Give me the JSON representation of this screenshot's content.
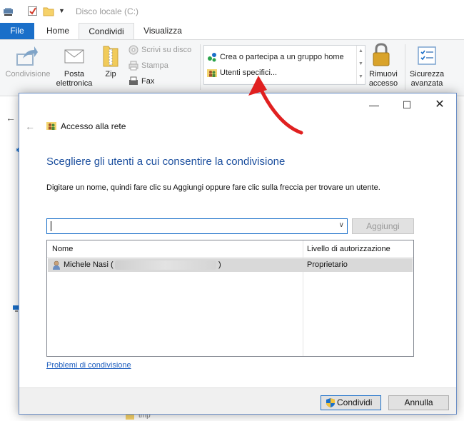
{
  "explorer": {
    "title": "Disco locale (C:)",
    "tabs": {
      "file": "File",
      "home": "Home",
      "share": "Condividi",
      "view": "Visualizza"
    },
    "ribbon": {
      "share_btn": "Condivisione",
      "email": "Posta elettronica",
      "zip": "Zip",
      "burn": "Scrivi su disco",
      "print": "Stampa",
      "fax": "Fax",
      "homegroup": "Crea o partecipa a un gruppo home",
      "specific_users": "Utenti specifici...",
      "remove_access": "Rimuovi accesso",
      "advanced_security": "Sicurezza avanzata"
    },
    "bottom_fragment": "tmp"
  },
  "dialog": {
    "window_title": "Accesso alla rete",
    "heading": "Scegliere gli utenti a cui consentire la condivisione",
    "instruction": "Digitare un nome, quindi fare clic su Aggiungi oppure fare clic sulla freccia per trovare un utente.",
    "input_value": "",
    "add_button": "Aggiungi",
    "columns": {
      "name": "Nome",
      "permission": "Livello di autorizzazione"
    },
    "rows": [
      {
        "name_prefix": "Michele Nasi (",
        "name_suffix": ")",
        "permission": "Proprietario"
      }
    ],
    "help_link": "Problemi di condivisione",
    "share_button": "Condividi",
    "cancel_button": "Annulla"
  },
  "colors": {
    "accent": "#1a6fc9",
    "heading": "#1c4f9e",
    "annotation": "#e02020"
  }
}
